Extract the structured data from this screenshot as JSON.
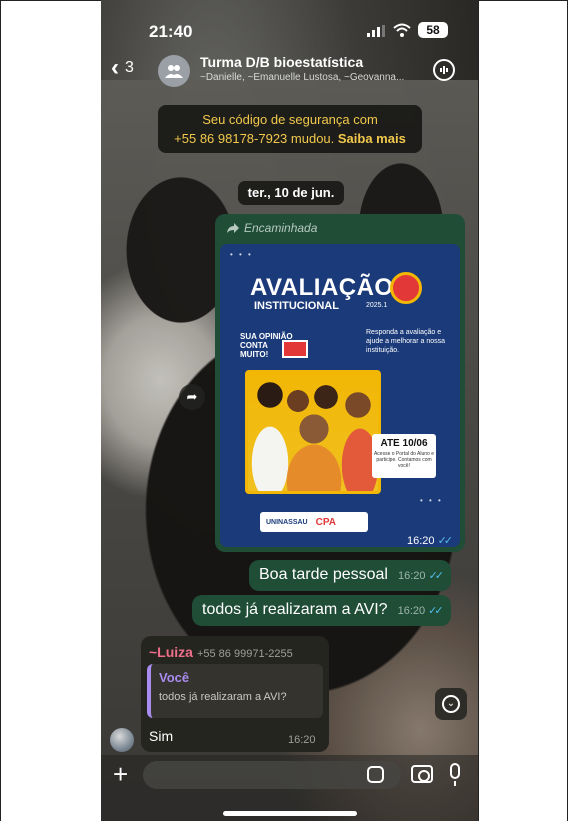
{
  "status_bar": {
    "time": "21:40",
    "battery": "58"
  },
  "header": {
    "back_count": "3",
    "title": "Turma D/B bioestatística",
    "subtitle": "~Danielle, ~Emanuelle Lustosa, ~Geovanna..."
  },
  "security_notice": {
    "line1": "Seu código de segurança com",
    "line2": "+55 86 98178-7923 mudou.",
    "link": "Saiba mais"
  },
  "date_chip": "ter., 10 de jun.",
  "forwarded_message": {
    "label": "Encaminhada",
    "time": "16:20",
    "poster": {
      "title": "AVALIAÇÃO",
      "subtitle": "INSTITUCIONAL",
      "year": "2025.1",
      "opinion": [
        "SUA OPINIÃO",
        "CONTA",
        "MUITO!"
      ],
      "call_to_action": "Responda a avaliação e ajude a melhorar a nossa instituição.",
      "deadline": "ATE 10/06",
      "deadline_note": "Acesse o Portal do Aluno e participe. Contamos com você!",
      "brand1": "UNINASSAU",
      "brand2": "CPA"
    }
  },
  "messages_out": [
    {
      "text": "Boa tarde pessoal",
      "time": "16:20"
    },
    {
      "text": "todos já realizaram a AVI?",
      "time": "16:20"
    }
  ],
  "message_in": {
    "sender": "~Luiza",
    "phone": "+55 86 99971-2255",
    "quoted_name": "Você",
    "quoted_text": "todos já realizaram a AVI?",
    "text": "Sim",
    "time": "16:20"
  },
  "colors": {
    "outgoing_bubble": "#1f4d36",
    "incoming_bubble": "#25251f",
    "sender_name": "#ef6e8a",
    "quote_accent": "#a98cf0",
    "read_ticks": "#53bdeb",
    "security_text": "#f2c94c"
  },
  "icons": [
    "chevron-left-icon",
    "group-icon",
    "voice-call-icon",
    "forward-icon",
    "share-icon",
    "scroll-down-icon",
    "plus-icon",
    "sticker-icon",
    "camera-icon",
    "mic-icon"
  ]
}
